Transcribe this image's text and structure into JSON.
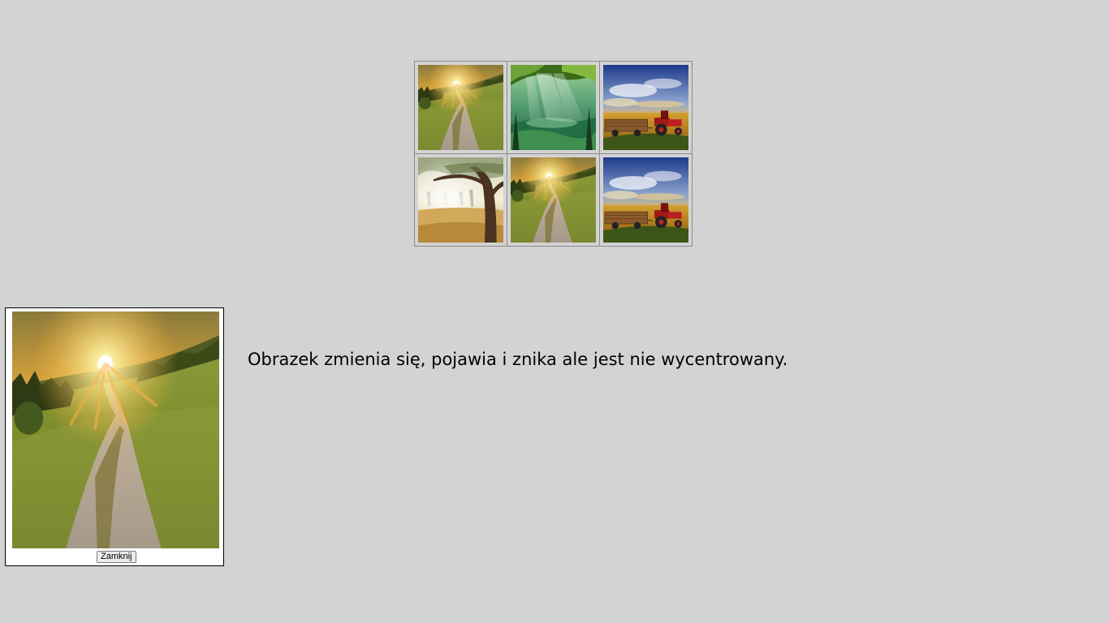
{
  "gallery": {
    "rows": [
      [
        {
          "icon": "sunset-country-road-photo"
        },
        {
          "icon": "forest-sunbeams-photo"
        },
        {
          "icon": "red-tractor-field-photo"
        }
      ],
      [
        {
          "icon": "misty-olive-grove-photo"
        },
        {
          "icon": "sunset-country-road-photo"
        },
        {
          "icon": "red-tractor-field-photo"
        }
      ]
    ]
  },
  "preview": {
    "image_icon": "sunset-country-road-photo",
    "close_label": "Zamknij"
  },
  "message": "Obrazek zmienia się, pojawia i znika ale jest nie wycentrowany."
}
